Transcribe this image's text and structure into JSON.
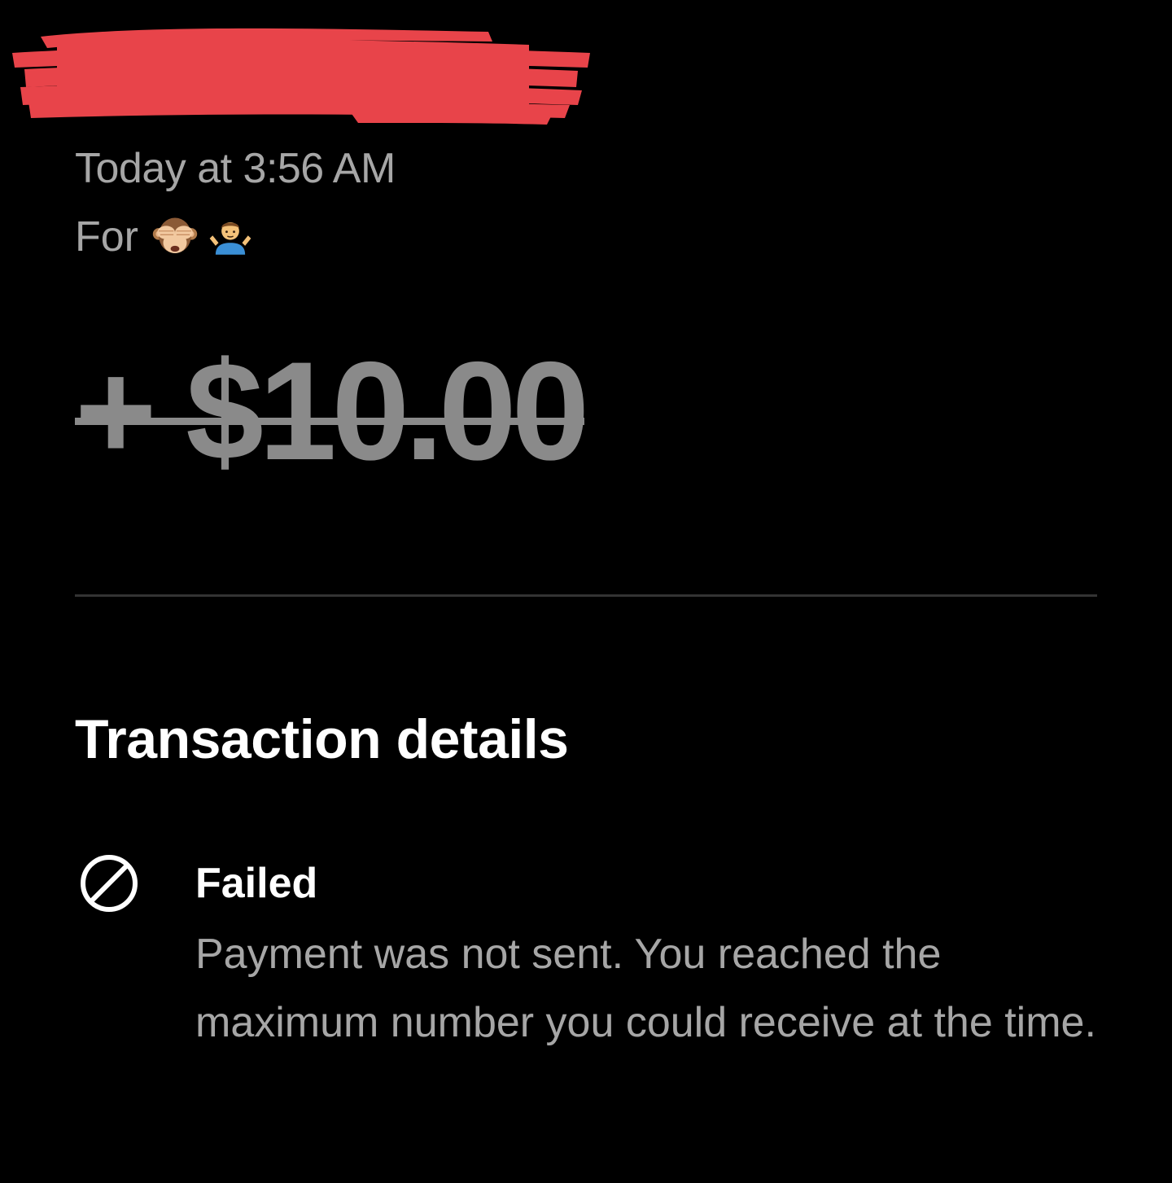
{
  "header": {
    "redacted": true
  },
  "transaction": {
    "timestamp": "Today at 3:56 AM",
    "for_label": "For",
    "for_emojis": [
      "see-no-evil-monkey-emoji",
      "shrugging-man-emoji"
    ],
    "amount": "+ $10.00",
    "amount_struck_through": true
  },
  "details": {
    "section_title": "Transaction details",
    "status_icon": "prohibited-icon",
    "status_label": "Failed",
    "status_description": "Payment was not sent. You reached the maximum number you could receive at the time."
  },
  "colors": {
    "background": "#000000",
    "redaction": "#e8444a",
    "muted_text": "#a6a6a6",
    "amount_text": "#8a8a8a",
    "primary_text": "#ffffff",
    "divider": "#333333"
  }
}
